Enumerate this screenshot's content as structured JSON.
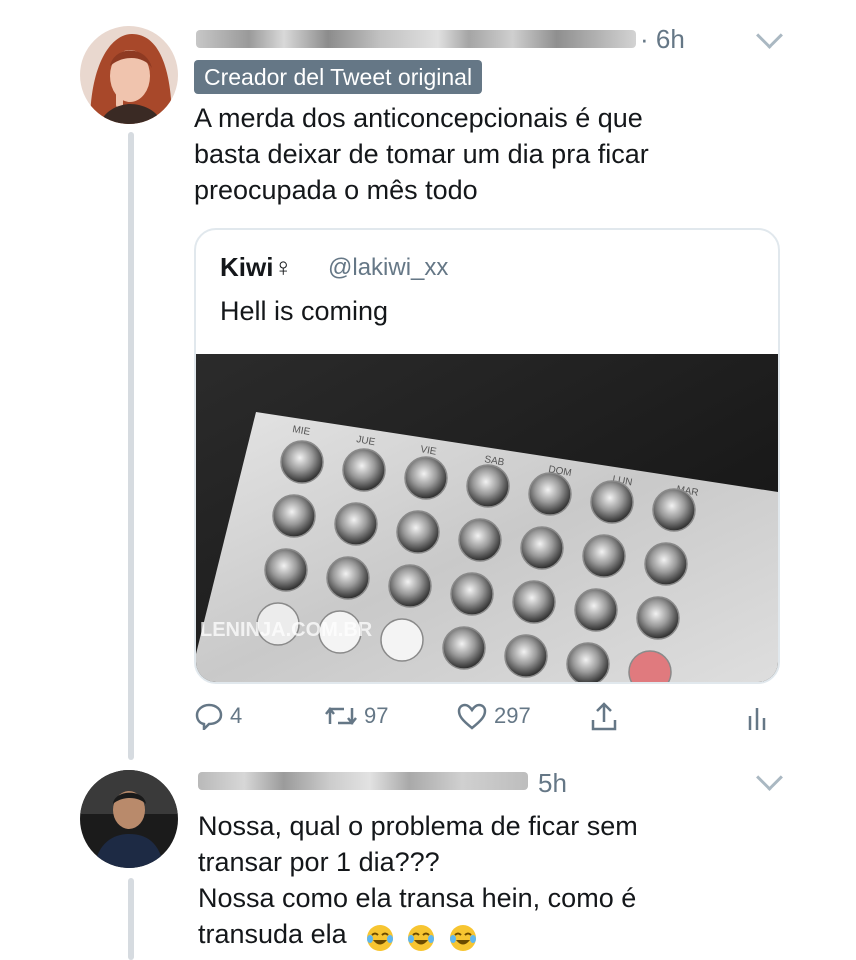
{
  "original_tweet": {
    "time": "· 6h",
    "badge": "Creador del Tweet original",
    "text_lines": [
      "A merda dos anticoncepcionais é que",
      "basta deixar de tomar um dia pra ficar",
      "preocupada o mês todo"
    ],
    "quoted": {
      "name": "Kiwi♀",
      "handle": "@lakiwi_xx",
      "text": "Hell is coming",
      "image_label": "birth control pill blister pack",
      "blister_days": [
        "MIE",
        "JUE",
        "VIE",
        "SAB",
        "DOM",
        "LUN",
        "MAR"
      ],
      "watermark": "LENINJA.COM.BR"
    },
    "actions": {
      "reply_count": "4",
      "retweet_count": "97",
      "like_count": "297"
    }
  },
  "reply_tweet": {
    "time": "5h",
    "text_lines": [
      "Nossa, qual o problema de ficar sem",
      "transar por 1 dia???",
      "Nossa como ela transa hein, como é",
      "transuda ela"
    ],
    "emojis": [
      "tears-of-joy",
      "tears-of-joy",
      "tears-of-joy"
    ]
  },
  "colors": {
    "secondary_text": "#657786",
    "thread_line": "#d6dbe0",
    "border": "#e1e8ed"
  }
}
